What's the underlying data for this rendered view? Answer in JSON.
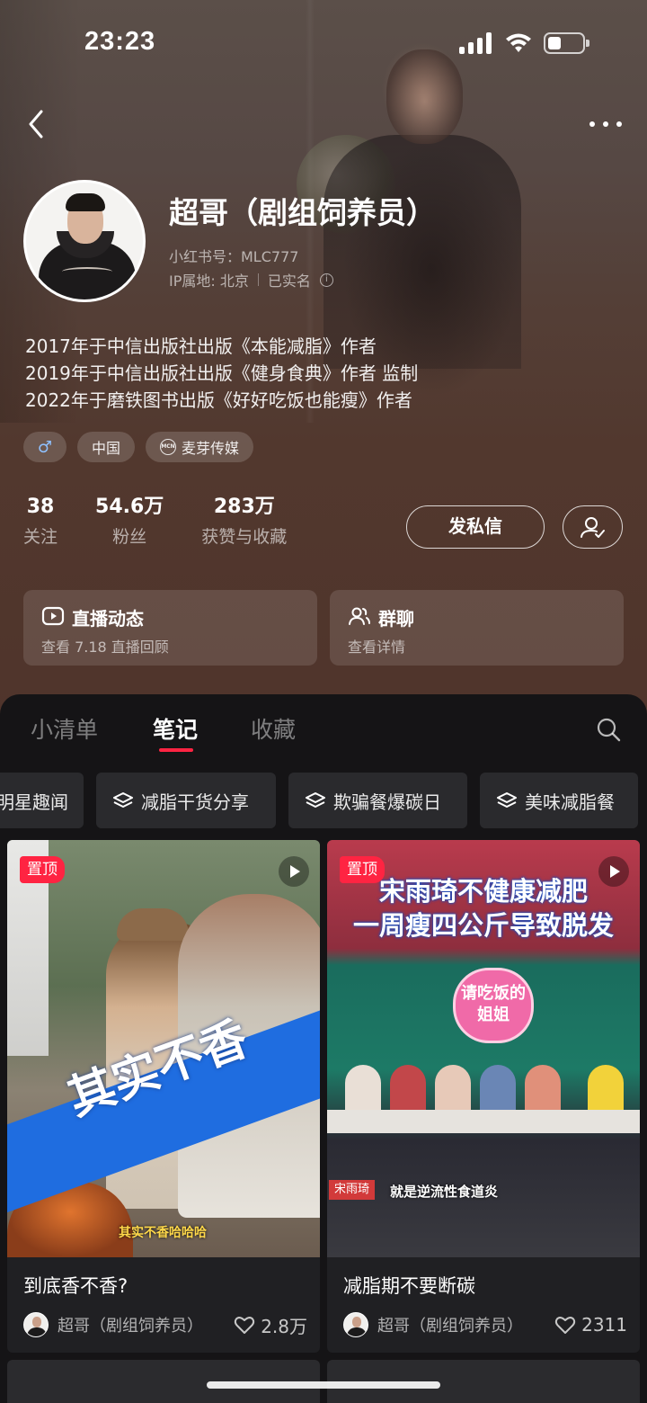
{
  "status_bar": {
    "time": "23:23"
  },
  "profile": {
    "name": "超哥（剧组饲养员）",
    "id_line": "小红书号：MLC777",
    "ip_location": "IP属地: 北京",
    "verified": "已实名",
    "bio": [
      "2017年于中信出版社出版《本能减脂》作者",
      "2019年于中信出版社出版《健身食典》作者 监制",
      "2022年于磨铁图书出版《好好吃饭也能瘦》作者"
    ],
    "tags": [
      {
        "icon": "male-symbol-icon",
        "label": "♂"
      },
      {
        "label": "中国"
      },
      {
        "icon": "mcn-icon",
        "badge": "MCN",
        "label": "麦芽传媒"
      }
    ],
    "stats": [
      {
        "value": "38",
        "label": "关注"
      },
      {
        "value": "54.6万",
        "label": "粉丝"
      },
      {
        "value": "283万",
        "label": "获赞与收藏"
      }
    ],
    "message_button": "发私信"
  },
  "features": {
    "live": {
      "title": "直播动态",
      "subtitle": "查看 7.18 直播回顾"
    },
    "group": {
      "title": "群聊",
      "subtitle": "查看详情"
    }
  },
  "tabs": [
    {
      "label": "小清单",
      "active": false
    },
    {
      "label": "笔记",
      "active": true
    },
    {
      "label": "收藏",
      "active": false
    }
  ],
  "chips": [
    "明星趣闻",
    "减脂干货分享",
    "欺骗餐爆碳日",
    "美味减脂餐"
  ],
  "notes": [
    {
      "pinned_label": "置顶",
      "overlay_text": "其实不香",
      "subtitle_text": "其实不香哈哈哈",
      "title": "到底香不香?",
      "author": "超哥（剧组饲养员）",
      "likes": "2.8万"
    },
    {
      "pinned_label": "置顶",
      "overlay_lines": [
        "宋雨琦不健康减肥",
        "一周瘦四公斤导致脱发"
      ],
      "sign_text": "请吃饭的姐姐",
      "name_tag": "宋雨琦",
      "subtitle_text": "就是逆流性食道炎",
      "title": "减脂期不要断碳",
      "author": "超哥（剧组饲养员）",
      "likes": "2311"
    }
  ],
  "colors": {
    "accent": "#ff2442",
    "header_bg": "#52382e",
    "content_bg": "#151416"
  }
}
